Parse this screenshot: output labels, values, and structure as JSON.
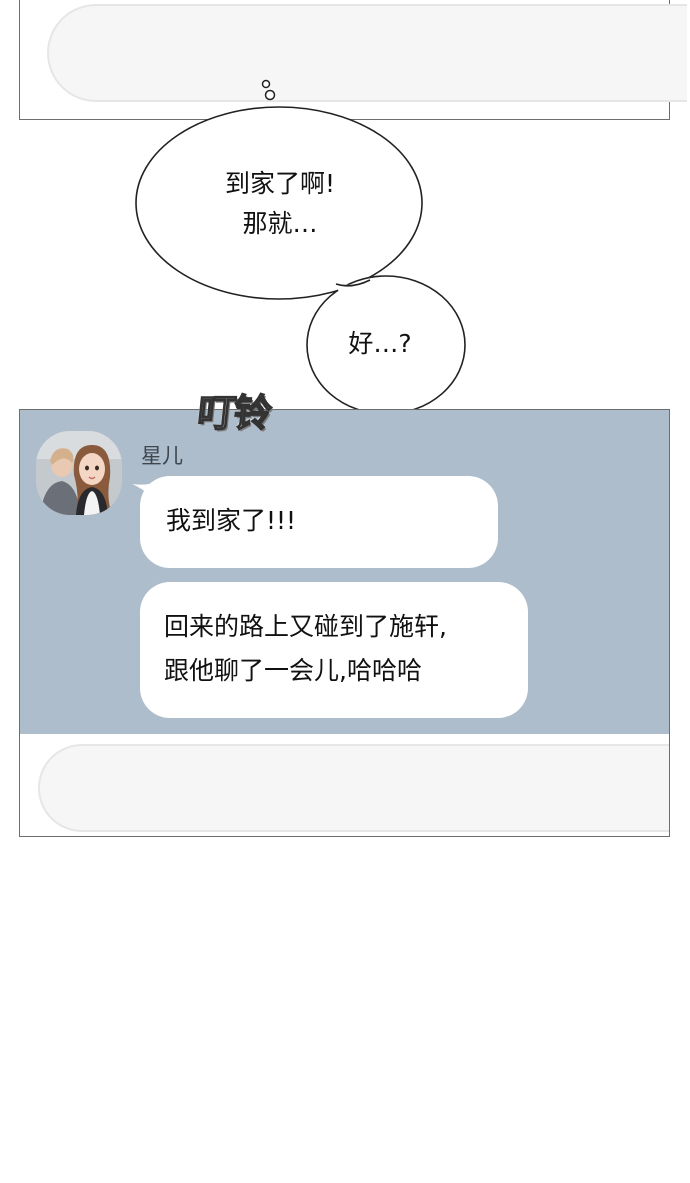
{
  "speech_bubbles": [
    {
      "lines": [
        "到家了啊!",
        "那就…"
      ]
    },
    {
      "lines": [
        "好…?"
      ]
    }
  ],
  "sound_effect": "叮铃",
  "chat": {
    "sender_name": "星儿",
    "messages": [
      {
        "lines": [
          "我到家了!!!"
        ]
      },
      {
        "lines": [
          "回来的路上又碰到了施轩,",
          "跟他聊了一会儿,哈哈哈"
        ]
      }
    ]
  },
  "colors": {
    "chat_background": "#aebdcc",
    "message_bubble": "#ffffff",
    "input_box": "#f6f6f6",
    "panel_border": "#6e6e6e"
  }
}
